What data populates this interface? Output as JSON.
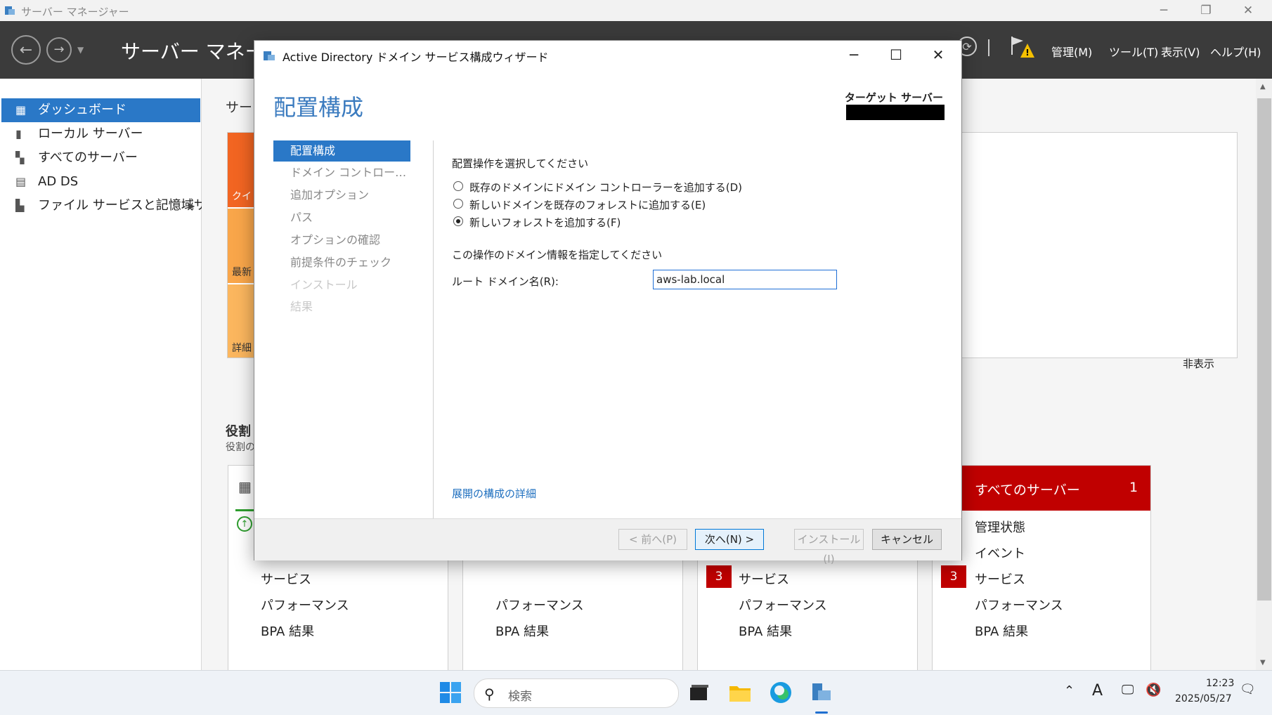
{
  "outer_window": {
    "title": "サーバー マネージャー"
  },
  "header": {
    "title": "サーバー マネージャー",
    "menus": [
      "管理(M)",
      "ツール(T)",
      "表示(V)",
      "ヘルプ(H)"
    ]
  },
  "sidebar": {
    "items": [
      {
        "label": "ダッシュボード",
        "icon": "dashboard-icon",
        "active": true
      },
      {
        "label": "ローカル サーバー",
        "icon": "server-icon"
      },
      {
        "label": "すべてのサーバー",
        "icon": "servers-icon"
      },
      {
        "label": "AD DS",
        "icon": "adds-icon"
      },
      {
        "label": "ファイル サービスと記憶域サ...",
        "icon": "file-services-icon"
      }
    ]
  },
  "dashboard": {
    "welcome_heading": "サー",
    "quick_labels": [
      "クイッ",
      "最新",
      "詳細"
    ],
    "hide_label": "非表示",
    "roles_heading": "役割",
    "roles_sub": "役割の",
    "tiles": [
      {
        "rows": [
          "サービス",
          "パフォーマンス",
          "BPA 結果"
        ],
        "badge": ""
      },
      {
        "rows": [
          "パフォーマンス",
          "BPA 結果"
        ],
        "badge": ""
      },
      {
        "rows": [
          "サービス",
          "パフォーマンス",
          "BPA 結果"
        ],
        "badge": "3"
      },
      {
        "title": "すべてのサーバー",
        "count": "1",
        "rows": [
          "管理状態",
          "イベント",
          "サービス",
          "パフォーマンス",
          "BPA 結果"
        ],
        "badge": "3"
      }
    ]
  },
  "wizard": {
    "title": "Active Directory ドメイン サービス構成ウィザード",
    "heading": "配置構成",
    "target_server_label": "ターゲット サーバー",
    "steps": [
      {
        "label": "配置構成",
        "state": "active"
      },
      {
        "label": "ドメイン コントローラー オプション",
        "state": "normal"
      },
      {
        "label": "追加オプション",
        "state": "normal"
      },
      {
        "label": "パス",
        "state": "normal"
      },
      {
        "label": "オプションの確認",
        "state": "normal"
      },
      {
        "label": "前提条件のチェック",
        "state": "normal"
      },
      {
        "label": "インストール",
        "state": "disabled"
      },
      {
        "label": "結果",
        "state": "disabled"
      }
    ],
    "select_operation_label": "配置操作を選択してください",
    "options": [
      {
        "label": "既存のドメインにドメイン コントローラーを追加する(D)",
        "checked": false
      },
      {
        "label": "新しいドメインを既存のフォレストに追加する(E)",
        "checked": false
      },
      {
        "label": "新しいフォレストを追加する(F)",
        "checked": true
      }
    ],
    "domain_info_label": "この操作のドメイン情報を指定してください",
    "root_domain_label": "ルート ドメイン名(R):",
    "root_domain_value": "aws-lab.local",
    "details_link": "展開の構成の詳細",
    "buttons": {
      "prev": "< 前へ(P)",
      "next": "次へ(N) >",
      "install": "インストール(I)",
      "cancel": "キャンセル"
    }
  },
  "taskbar": {
    "search_placeholder": "検索",
    "time": "12:23",
    "date": "2025/05/27",
    "ime": "A"
  },
  "colors": {
    "accent": "#2a78c7",
    "header_bg": "#3b3b3b",
    "alert_red": "#c00000",
    "quick_orange": "#f26522",
    "quick_light_orange": "#f9a64a"
  }
}
